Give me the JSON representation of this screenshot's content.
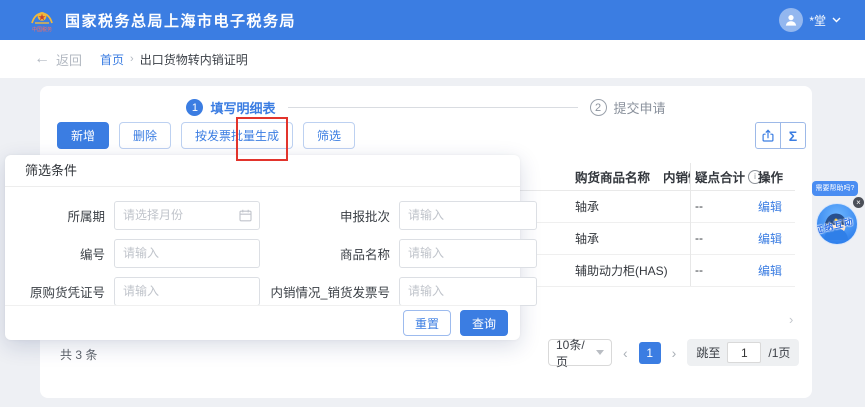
{
  "colors": {
    "primary_blue": "#3b7de2",
    "header_blue": "#3b7de2",
    "annotation_red": "#e2342c",
    "page_bg": "#eef0f4"
  },
  "header": {
    "title": "国家税务总局上海市电子税务局",
    "logo_caption": "中国税务",
    "user": {
      "name": "*堂"
    }
  },
  "breadcrumb": {
    "back_arrow": "←",
    "back": "返回",
    "home": "首页",
    "separator": "›",
    "current": "出口货物转内销证明"
  },
  "stepper": {
    "steps": [
      {
        "num": "1",
        "label": "填写明细表"
      },
      {
        "num": "2",
        "label": "提交申请"
      }
    ]
  },
  "toolbar": {
    "add": "新增",
    "delete": "删除",
    "batch_generate": "按发票批量生成",
    "filter": "筛选",
    "sigma_icon": "Σ"
  },
  "filter_panel": {
    "title": "筛选条件",
    "rows": [
      [
        {
          "label": "所属期",
          "placeholder": "请选择月份"
        },
        {
          "label": "申报批次",
          "placeholder": "请输入"
        }
      ],
      [
        {
          "label": "编号",
          "placeholder": "请输入"
        },
        {
          "label": "商品名称",
          "placeholder": "请输入"
        }
      ],
      [
        {
          "label": "原购货凭证号",
          "placeholder": "请输入"
        },
        {
          "label": "内销情况_销货发票号",
          "placeholder": "请输入"
        }
      ]
    ],
    "reset": "重置",
    "query": "查询"
  },
  "table": {
    "headers": [
      {
        "label": "购货商品名称"
      },
      {
        "label": "内销情"
      },
      {
        "label": "疑点合计",
        "info_glyph": "i"
      },
      {
        "label": "操作"
      }
    ],
    "rows": [
      {
        "name": "轴承",
        "doubt_total": "--",
        "action": "编辑"
      },
      {
        "name": "轴承",
        "doubt_total": "--",
        "action": "编辑"
      },
      {
        "name": "辅助动力柜(HAS)",
        "doubt_total": "--",
        "action": "编辑"
      }
    ],
    "scroll_right_glyph": "›"
  },
  "pagination": {
    "total": "共 3 条",
    "page_size": "10条/页",
    "prev_glyph": "‹",
    "page": "1",
    "next_glyph": "›",
    "jump_label": "跳至",
    "jump_value": "1",
    "total_pages": "/1页"
  },
  "assistant": {
    "tooltip": "需要帮助吗?",
    "close_glyph": "×",
    "badge": "征纳互动"
  }
}
